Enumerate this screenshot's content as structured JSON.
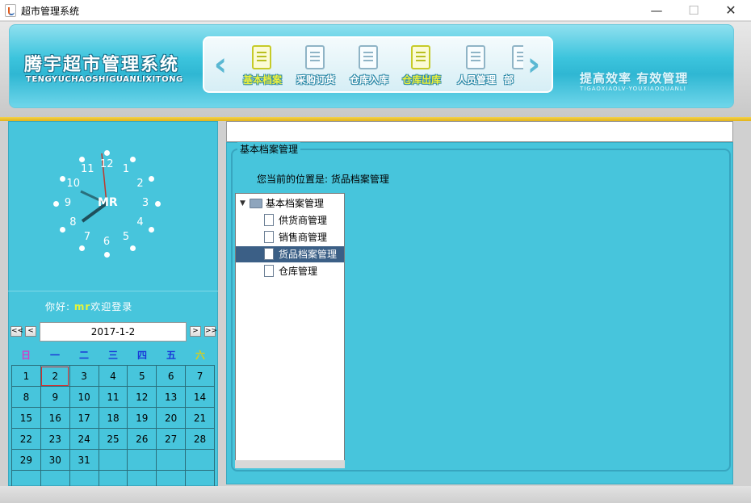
{
  "window": {
    "title": "超市管理系统",
    "min": "—",
    "max": "☐",
    "close": "✕"
  },
  "header": {
    "logo_cn": "腾宇超市管理系统",
    "logo_en": "TENGYUCHAOSHIGUANLIXITONG",
    "nav_prev": "‹",
    "nav_next": "›",
    "nav_items": [
      {
        "label": "基本档案",
        "icon": "archive-icon",
        "active": true
      },
      {
        "label": "采购订货",
        "icon": "purchase-icon",
        "active": false
      },
      {
        "label": "仓库入库",
        "icon": "warehouse-in-icon",
        "active": false
      },
      {
        "label": "仓库出库",
        "icon": "warehouse-out-icon",
        "active": false
      },
      {
        "label": "人员管理",
        "icon": "staff-icon",
        "active": false
      },
      {
        "label": "部",
        "icon": "department-icon",
        "active": false
      }
    ],
    "slogan_cn": "提高效率  有效管理",
    "slogan_en": "TIGAOXIAOLV·YOUXIAOQUANLI"
  },
  "clock": {
    "center_label": "MR",
    "numbers": [
      "12",
      "1",
      "2",
      "3",
      "4",
      "5",
      "6",
      "7",
      "8",
      "9",
      "10",
      "11"
    ]
  },
  "greeting": {
    "prefix": "你好:",
    "user": "mr",
    "suffix": "欢迎登录"
  },
  "calendar": {
    "prev_year": "<<",
    "prev_month": "<",
    "next_month": ">",
    "next_year": ">>",
    "date": "2017-1-2",
    "weekdays": [
      "日",
      "一",
      "二",
      "三",
      "四",
      "五",
      "六"
    ],
    "weekday_colors": [
      "#d23cc8",
      "#1a3ad8",
      "#1a3ad8",
      "#1a3ad8",
      "#1a3ad8",
      "#1a3ad8",
      "#d7cf1c"
    ],
    "weeks": [
      [
        "1",
        "2",
        "3",
        "4",
        "5",
        "6",
        "7"
      ],
      [
        "8",
        "9",
        "10",
        "11",
        "12",
        "13",
        "14"
      ],
      [
        "15",
        "16",
        "17",
        "18",
        "19",
        "20",
        "21"
      ],
      [
        "22",
        "23",
        "24",
        "25",
        "26",
        "27",
        "28"
      ],
      [
        "29",
        "30",
        "31",
        "",
        "",
        "",
        ""
      ],
      [
        "",
        "",
        "",
        "",
        "",
        "",
        ""
      ]
    ],
    "today": "2"
  },
  "main": {
    "group_title": "基本档案管理",
    "location": "您当前的位置是: 货品档案管理",
    "tree": {
      "root": "基本档案管理",
      "children": [
        "供货商管理",
        "销售商管理",
        "货品档案管理",
        "仓库管理"
      ],
      "selected": "货品档案管理"
    }
  }
}
